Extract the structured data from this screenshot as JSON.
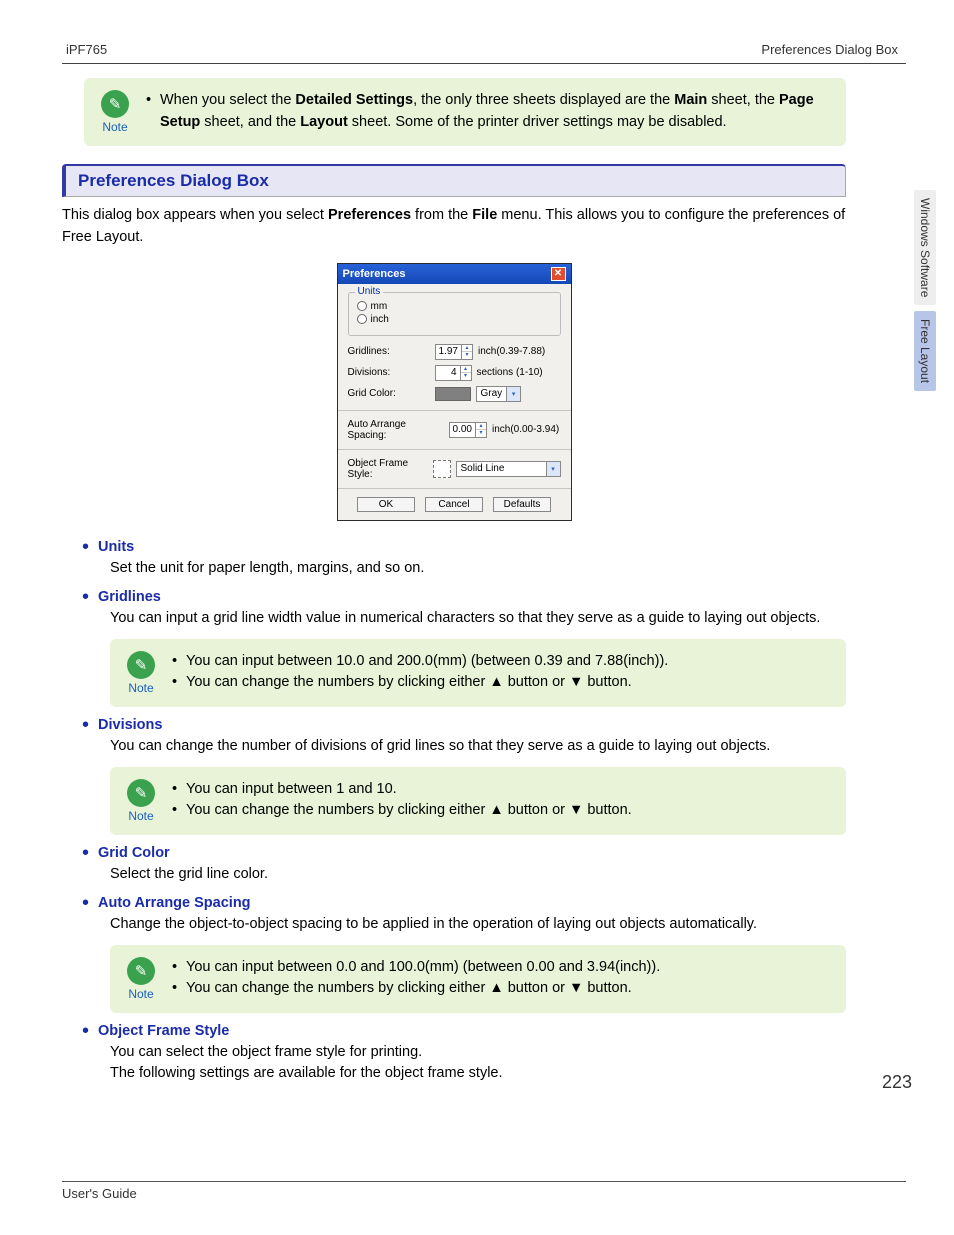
{
  "header": {
    "left": "iPF765",
    "right": "Preferences Dialog Box"
  },
  "top_note": {
    "label": "Note",
    "items": [
      {
        "pre": "When you select the ",
        "b1": "Detailed Settings",
        "mid1": ", the only three sheets displayed are the ",
        "b2": "Main",
        "mid2": " sheet, the ",
        "b3": "Page Setup",
        "mid3": " sheet, and the ",
        "b4": "Layout",
        "post": " sheet. Some of the printer driver settings may be disabled."
      }
    ]
  },
  "section_title": "Preferences Dialog Box",
  "intro": {
    "pre": "This dialog box appears when you select ",
    "b1": "Preferences",
    "mid": " from the ",
    "b2": "File",
    "post": " menu. This allows you to configure the preferences of Free Layout."
  },
  "dialog": {
    "title": "Preferences",
    "units_legend": "Units",
    "unit_mm": "mm",
    "unit_inch": "inch",
    "gridlines_label": "Gridlines:",
    "gridlines_value": "1.97",
    "gridlines_hint": "inch(0.39-7.88)",
    "divisions_label": "Divisions:",
    "divisions_value": "4",
    "divisions_hint": "sections (1-10)",
    "gridcolor_label": "Grid Color:",
    "gridcolor_value": "Gray",
    "spacing_label": "Auto Arrange Spacing:",
    "spacing_value": "0.00",
    "spacing_hint": "inch(0.00-3.94)",
    "frame_label": "Object Frame Style:",
    "frame_value": "Solid Line",
    "ok": "OK",
    "cancel": "Cancel",
    "defaults": "Defaults"
  },
  "topics": {
    "units": {
      "title": "Units",
      "body": "Set the unit for paper length, margins, and so on."
    },
    "gridlines": {
      "title": "Gridlines",
      "body": "You can input a grid line width value in numerical characters so that they serve as a guide to laying out objects.",
      "note": {
        "label": "Note",
        "items": [
          "You can input between 10.0 and 200.0(mm) (between 0.39 and 7.88(inch)).",
          "You can change the numbers by clicking either ▲ button or ▼ button."
        ]
      }
    },
    "divisions": {
      "title": "Divisions",
      "body": "You can change the number of divisions of grid lines so that they serve as a guide to laying out objects.",
      "note": {
        "label": "Note",
        "items": [
          "You can input between 1 and 10.",
          "You can change the numbers by clicking either ▲ button or ▼ button."
        ]
      }
    },
    "gridcolor": {
      "title": "Grid Color",
      "body": "Select the grid line color."
    },
    "spacing": {
      "title": "Auto Arrange Spacing",
      "body": "Change the object-to-object spacing to be applied in the operation of laying out objects automatically.",
      "note": {
        "label": "Note",
        "items": [
          "You can input between 0.0 and 100.0(mm) (between 0.00 and 3.94(inch)).",
          "You can change the numbers by clicking either ▲ button or ▼ button."
        ]
      }
    },
    "frame": {
      "title": "Object Frame Style",
      "body1": "You can select the object frame style for printing.",
      "body2": "The following settings are available for the object frame style."
    }
  },
  "side": {
    "tab1": "Windows Software",
    "tab2": "Free Layout"
  },
  "page_number": "223",
  "footer": "User's Guide"
}
